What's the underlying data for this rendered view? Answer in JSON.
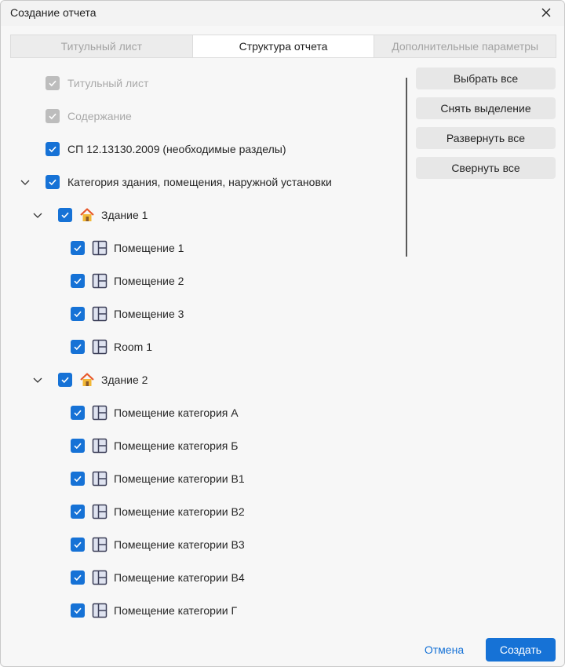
{
  "window": {
    "title": "Создание отчета",
    "close_icon": "close-icon"
  },
  "tabs": [
    {
      "label": "Титульный лист",
      "active": false
    },
    {
      "label": "Структура отчета",
      "active": true
    },
    {
      "label": "Дополнительные параметры",
      "active": false
    }
  ],
  "tree": {
    "title_page": "Титульный лист",
    "contents": "Содержание",
    "sp": "СП 12.13130.2009 (необходимые разделы)",
    "category": "Категория здания, помещения, наружной установки",
    "building1": {
      "label": "Здание 1",
      "icon": "house-icon",
      "rooms": [
        "Помещение 1",
        "Помещение 2",
        "Помещение 3",
        "Room 1"
      ]
    },
    "building2": {
      "label": "Здание 2",
      "icon": "house-icon",
      "rooms": [
        "Помещение категория А",
        "Помещение категория Б",
        "Помещение категории В1",
        "Помещение категории В2",
        "Помещение категории В3",
        "Помещение категории В4",
        "Помещение категории Г"
      ]
    },
    "room_icon": "room-layout-icon",
    "checkbox_color": "#1672d6",
    "disabled_checkbox_color": "#bdbdbd"
  },
  "side_buttons": {
    "select_all": "Выбрать все",
    "deselect": "Снять выделение",
    "expand_all": "Развернуть все",
    "collapse_all": "Свернуть все"
  },
  "footer": {
    "cancel": "Отмена",
    "create": "Создать",
    "accent": "#1672d6"
  }
}
